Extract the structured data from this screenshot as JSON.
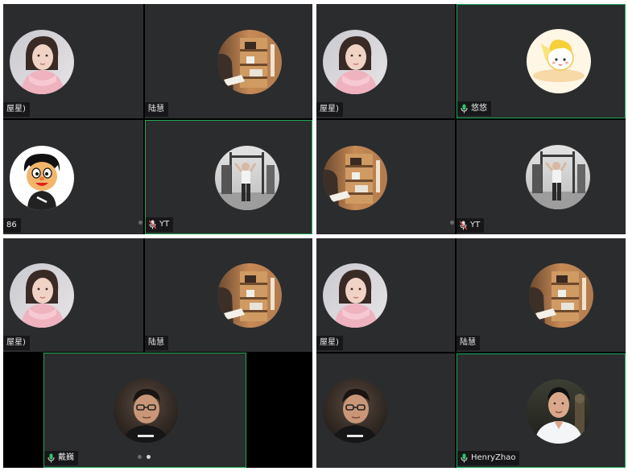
{
  "colors": {
    "tile_bg": "#2b2c2e",
    "active_border": "#1fa855",
    "screen_bg": "#000000",
    "mic_green": "#33c26b"
  },
  "panels": [
    {
      "tiles": [
        {
          "name": "屋星)",
          "avatar": "woman-photo"
        },
        {
          "name": "陆慧",
          "avatar": "shelf-photo"
        },
        {
          "name": "86",
          "avatar": "cartoon-boy"
        },
        {
          "name": "YT",
          "avatar": "gym-photo",
          "icon": "mic-off-icon"
        }
      ]
    },
    {
      "tiles": [
        {
          "name": "屋星)",
          "avatar": "woman-photo"
        },
        {
          "name": "悠悠",
          "avatar": "cartoon-girl",
          "icon": "mic-icon"
        },
        {
          "name": "",
          "avatar": "shelf-photo"
        },
        {
          "name": "YT",
          "avatar": "gym-photo",
          "icon": "mic-muted-icon"
        }
      ]
    },
    {
      "tiles": [
        {
          "name": "屋星)",
          "avatar": "woman-photo"
        },
        {
          "name": "陆慧",
          "avatar": "shelf-photo"
        },
        {
          "name": "戴巍",
          "avatar": "man-glasses-photo",
          "icon": "mic-icon"
        }
      ]
    },
    {
      "tiles": [
        {
          "name": "屋星)",
          "avatar": "woman-photo"
        },
        {
          "name": "陆慧",
          "avatar": "shelf-photo"
        },
        {
          "name": "",
          "avatar": "man-glasses-photo"
        },
        {
          "name": "HenryZhao",
          "avatar": "man-outdoor-photo",
          "icon": "mic-icon"
        }
      ]
    }
  ]
}
